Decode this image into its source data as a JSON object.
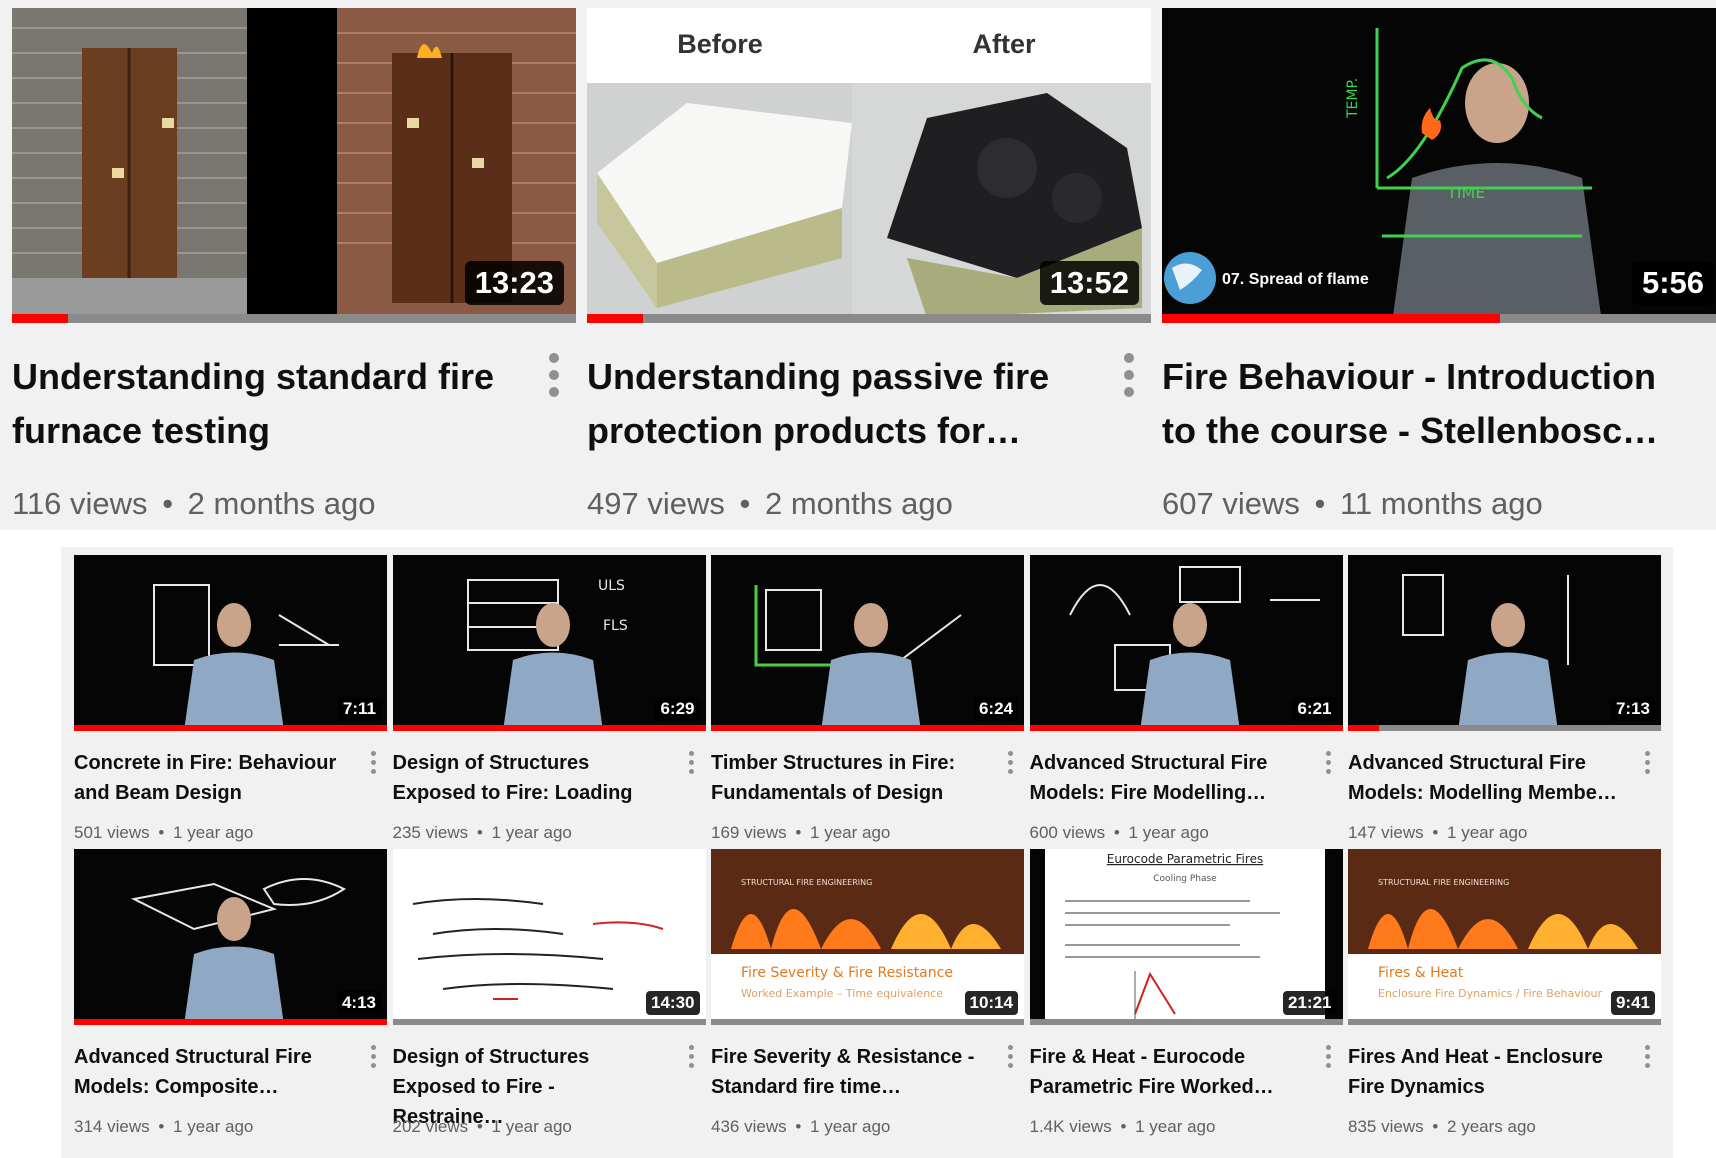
{
  "featured_videos": [
    {
      "title": "Understanding standard fire furnace testing",
      "duration": "13:23",
      "views": "116 views",
      "age": "2 months ago",
      "progress": 0.1
    },
    {
      "title": "Understanding passive fire protection products for…",
      "duration": "13:52",
      "views": "497 views",
      "age": "2 months ago",
      "progress": 0.1,
      "thumb_before": "Before",
      "thumb_after": "After"
    },
    {
      "title": "Fire Behaviour - Introduction to the course - Stellenbosc…",
      "duration": "5:56",
      "views": "607 views",
      "age": "11 months ago",
      "progress": 0.6,
      "thumb_caption": "07. Spread of flame"
    }
  ],
  "grid_videos": [
    {
      "title": "Concrete in Fire: Behaviour and Beam Design",
      "duration": "7:11",
      "views": "501 views",
      "age": "1 year ago",
      "progress": 1.0
    },
    {
      "title": "Design of Structures Exposed to Fire: Loading",
      "duration": "6:29",
      "views": "235 views",
      "age": "1 year ago",
      "progress": 1.0
    },
    {
      "title": "Timber Structures in Fire: Fundamentals of Design",
      "duration": "6:24",
      "views": "169 views",
      "age": "1 year ago",
      "progress": 1.0
    },
    {
      "title": "Advanced Structural Fire Models: Fire Modelling…",
      "duration": "6:21",
      "views": "600 views",
      "age": "1 year ago",
      "progress": 1.0
    },
    {
      "title": "Advanced Structural Fire Models: Modelling Membe…",
      "duration": "7:13",
      "views": "147 views",
      "age": "1 year ago",
      "progress": 0.1
    },
    {
      "title": "Advanced Structural Fire Models: Composite…",
      "duration": "4:13",
      "views": "314 views",
      "age": "1 year ago",
      "progress": 1.0
    },
    {
      "title": "Design of Structures Exposed to Fire - Restraine…",
      "duration": "14:30",
      "views": "202 views",
      "age": "1 year ago",
      "progress": 0.0
    },
    {
      "title": "Fire Severity & Resistance - Standard fire time…",
      "duration": "10:14",
      "views": "436 views",
      "age": "1 year ago",
      "progress": 0.0,
      "thumb_title": "Fire Severity & Fire Resistance",
      "thumb_subtitle": "Worked Example – Time equivalence",
      "thumb_header": "STRUCTURAL FIRE ENGINEERING"
    },
    {
      "title": "Fire & Heat - Eurocode Parametric Fire Worked…",
      "duration": "21:21",
      "views": "1.4K views",
      "age": "1 year ago",
      "progress": 0.0,
      "thumb_title": "Eurocode Parametric Fires",
      "thumb_subtitle": "Cooling Phase"
    },
    {
      "title": "Fires And Heat - Enclosure Fire Dynamics",
      "duration": "9:41",
      "views": "835 views",
      "age": "2 years ago",
      "progress": 0.0,
      "thumb_title": "Fires & Heat",
      "thumb_subtitle": "Enclosure Fire Dynamics / Fire Behaviour",
      "thumb_header": "STRUCTURAL FIRE ENGINEERING"
    }
  ],
  "meta_separator": "•",
  "colors": {
    "progress": "#ff0000",
    "page_bg": "#f1f1f1",
    "meta_text": "#606060"
  }
}
